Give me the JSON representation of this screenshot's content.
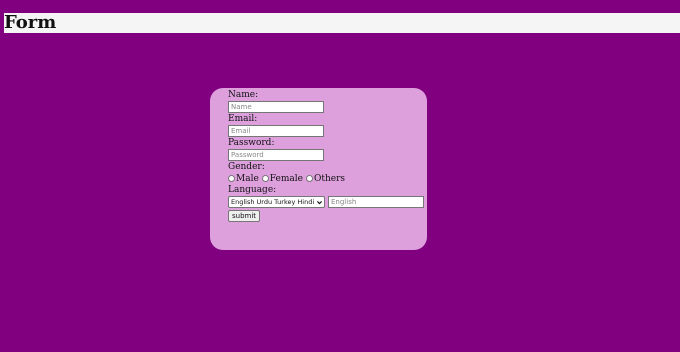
{
  "header": {
    "title": "Form"
  },
  "form": {
    "name_label": "Name:",
    "name_placeholder": "Name",
    "email_label": "Email:",
    "email_placeholder": "Email",
    "password_label": "Password:",
    "password_placeholder": "Password",
    "gender_label": "Gender:",
    "gender_options": [
      "Male",
      "Female",
      "Others"
    ],
    "language_label": "Language:",
    "language_select_display": "English Urdu Turkey Hindi",
    "language_input_placeholder": "English",
    "submit_label": "submit"
  },
  "colors": {
    "background": "#800080",
    "card": "#dda0dd",
    "header_bar": "#f5f5f5"
  },
  "icons": {
    "select_arrow": "chevron-down-icon"
  }
}
